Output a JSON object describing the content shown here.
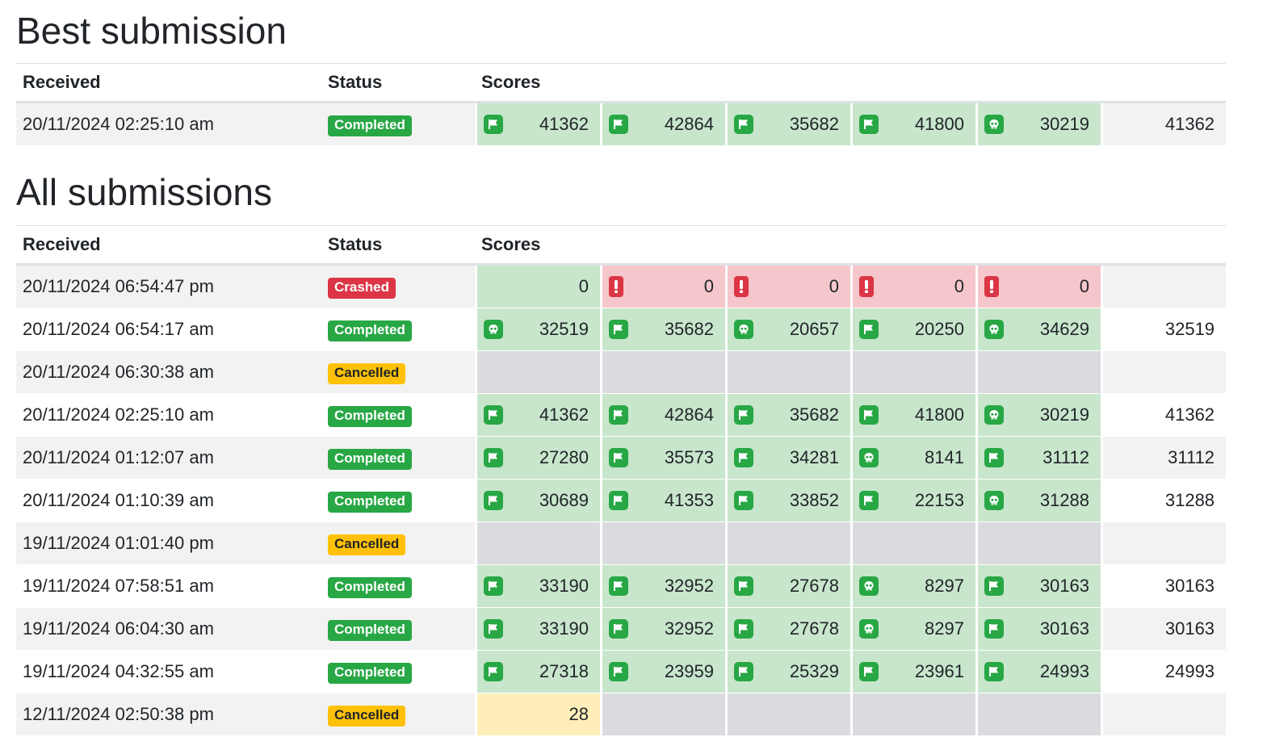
{
  "best": {
    "title": "Best submission",
    "headers": {
      "received": "Received",
      "status": "Status",
      "scores": "Scores"
    },
    "row": {
      "received": "20/11/2024 02:25:10 am",
      "status": "Completed",
      "status_kind": "completed",
      "scores": [
        {
          "icon": "flag",
          "value": "41362"
        },
        {
          "icon": "flag",
          "value": "42864"
        },
        {
          "icon": "flag",
          "value": "35682"
        },
        {
          "icon": "flag",
          "value": "41800"
        },
        {
          "icon": "skull",
          "value": "30219"
        }
      ],
      "total": "41362"
    }
  },
  "all": {
    "title": "All submissions",
    "headers": {
      "received": "Received",
      "status": "Status",
      "scores": "Scores"
    },
    "rows": [
      {
        "received": "20/11/2024 06:54:47 pm",
        "status": "Crashed",
        "status_kind": "crashed",
        "scores": [
          {
            "icon": "",
            "value": "0",
            "bg": "success"
          },
          {
            "icon": "error",
            "value": "0",
            "bg": "danger"
          },
          {
            "icon": "error",
            "value": "0",
            "bg": "danger"
          },
          {
            "icon": "error",
            "value": "0",
            "bg": "danger"
          },
          {
            "icon": "error",
            "value": "0",
            "bg": "danger"
          }
        ],
        "total": ""
      },
      {
        "received": "20/11/2024 06:54:17 am",
        "status": "Completed",
        "status_kind": "completed",
        "scores": [
          {
            "icon": "skull",
            "value": "32519",
            "bg": "success"
          },
          {
            "icon": "flag",
            "value": "35682",
            "bg": "success"
          },
          {
            "icon": "skull",
            "value": "20657",
            "bg": "success"
          },
          {
            "icon": "flag",
            "value": "20250",
            "bg": "success"
          },
          {
            "icon": "skull",
            "value": "34629",
            "bg": "success"
          }
        ],
        "total": "32519"
      },
      {
        "received": "20/11/2024 06:30:38 am",
        "status": "Cancelled",
        "status_kind": "cancelled",
        "scores": [
          {
            "icon": "",
            "value": "",
            "bg": "empty"
          },
          {
            "icon": "",
            "value": "",
            "bg": "empty"
          },
          {
            "icon": "",
            "value": "",
            "bg": "empty"
          },
          {
            "icon": "",
            "value": "",
            "bg": "empty"
          },
          {
            "icon": "",
            "value": "",
            "bg": "empty"
          }
        ],
        "total": ""
      },
      {
        "received": "20/11/2024 02:25:10 am",
        "status": "Completed",
        "status_kind": "completed",
        "scores": [
          {
            "icon": "flag",
            "value": "41362",
            "bg": "success"
          },
          {
            "icon": "flag",
            "value": "42864",
            "bg": "success"
          },
          {
            "icon": "flag",
            "value": "35682",
            "bg": "success"
          },
          {
            "icon": "flag",
            "value": "41800",
            "bg": "success"
          },
          {
            "icon": "skull",
            "value": "30219",
            "bg": "success"
          }
        ],
        "total": "41362"
      },
      {
        "received": "20/11/2024 01:12:07 am",
        "status": "Completed",
        "status_kind": "completed",
        "scores": [
          {
            "icon": "flag",
            "value": "27280",
            "bg": "success"
          },
          {
            "icon": "flag",
            "value": "35573",
            "bg": "success"
          },
          {
            "icon": "flag",
            "value": "34281",
            "bg": "success"
          },
          {
            "icon": "skull",
            "value": "8141",
            "bg": "success"
          },
          {
            "icon": "flag",
            "value": "31112",
            "bg": "success"
          }
        ],
        "total": "31112"
      },
      {
        "received": "20/11/2024 01:10:39 am",
        "status": "Completed",
        "status_kind": "completed",
        "scores": [
          {
            "icon": "flag",
            "value": "30689",
            "bg": "success"
          },
          {
            "icon": "flag",
            "value": "41353",
            "bg": "success"
          },
          {
            "icon": "flag",
            "value": "33852",
            "bg": "success"
          },
          {
            "icon": "flag",
            "value": "22153",
            "bg": "success"
          },
          {
            "icon": "skull",
            "value": "31288",
            "bg": "success"
          }
        ],
        "total": "31288"
      },
      {
        "received": "19/11/2024 01:01:40 pm",
        "status": "Cancelled",
        "status_kind": "cancelled",
        "scores": [
          {
            "icon": "",
            "value": "",
            "bg": "empty"
          },
          {
            "icon": "",
            "value": "",
            "bg": "empty"
          },
          {
            "icon": "",
            "value": "",
            "bg": "empty"
          },
          {
            "icon": "",
            "value": "",
            "bg": "empty"
          },
          {
            "icon": "",
            "value": "",
            "bg": "empty"
          }
        ],
        "total": ""
      },
      {
        "received": "19/11/2024 07:58:51 am",
        "status": "Completed",
        "status_kind": "completed",
        "scores": [
          {
            "icon": "flag",
            "value": "33190",
            "bg": "success"
          },
          {
            "icon": "flag",
            "value": "32952",
            "bg": "success"
          },
          {
            "icon": "flag",
            "value": "27678",
            "bg": "success"
          },
          {
            "icon": "skull",
            "value": "8297",
            "bg": "success"
          },
          {
            "icon": "flag",
            "value": "30163",
            "bg": "success"
          }
        ],
        "total": "30163"
      },
      {
        "received": "19/11/2024 06:04:30 am",
        "status": "Completed",
        "status_kind": "completed",
        "scores": [
          {
            "icon": "flag",
            "value": "33190",
            "bg": "success"
          },
          {
            "icon": "flag",
            "value": "32952",
            "bg": "success"
          },
          {
            "icon": "flag",
            "value": "27678",
            "bg": "success"
          },
          {
            "icon": "skull",
            "value": "8297",
            "bg": "success"
          },
          {
            "icon": "flag",
            "value": "30163",
            "bg": "success"
          }
        ],
        "total": "30163"
      },
      {
        "received": "19/11/2024 04:32:55 am",
        "status": "Completed",
        "status_kind": "completed",
        "scores": [
          {
            "icon": "flag",
            "value": "27318",
            "bg": "success"
          },
          {
            "icon": "flag",
            "value": "23959",
            "bg": "success"
          },
          {
            "icon": "flag",
            "value": "25329",
            "bg": "success"
          },
          {
            "icon": "flag",
            "value": "23961",
            "bg": "success"
          },
          {
            "icon": "flag",
            "value": "24993",
            "bg": "success"
          }
        ],
        "total": "24993"
      },
      {
        "received": "12/11/2024 02:50:38 pm",
        "status": "Cancelled",
        "status_kind": "cancelled",
        "scores": [
          {
            "icon": "",
            "value": "28",
            "bg": "warn"
          },
          {
            "icon": "",
            "value": "",
            "bg": "empty"
          },
          {
            "icon": "",
            "value": "",
            "bg": "empty"
          },
          {
            "icon": "",
            "value": "",
            "bg": "empty"
          },
          {
            "icon": "",
            "value": "",
            "bg": "empty"
          }
        ],
        "total": ""
      }
    ]
  },
  "colors": {
    "success_bg": "#c8e6cc",
    "danger_bg": "#f5c6cb",
    "empty_bg": "#dadbde",
    "warn_bg": "#ffeeba",
    "badge_completed": "#28a745",
    "badge_crashed": "#dc3545",
    "badge_cancelled": "#ffc107"
  }
}
